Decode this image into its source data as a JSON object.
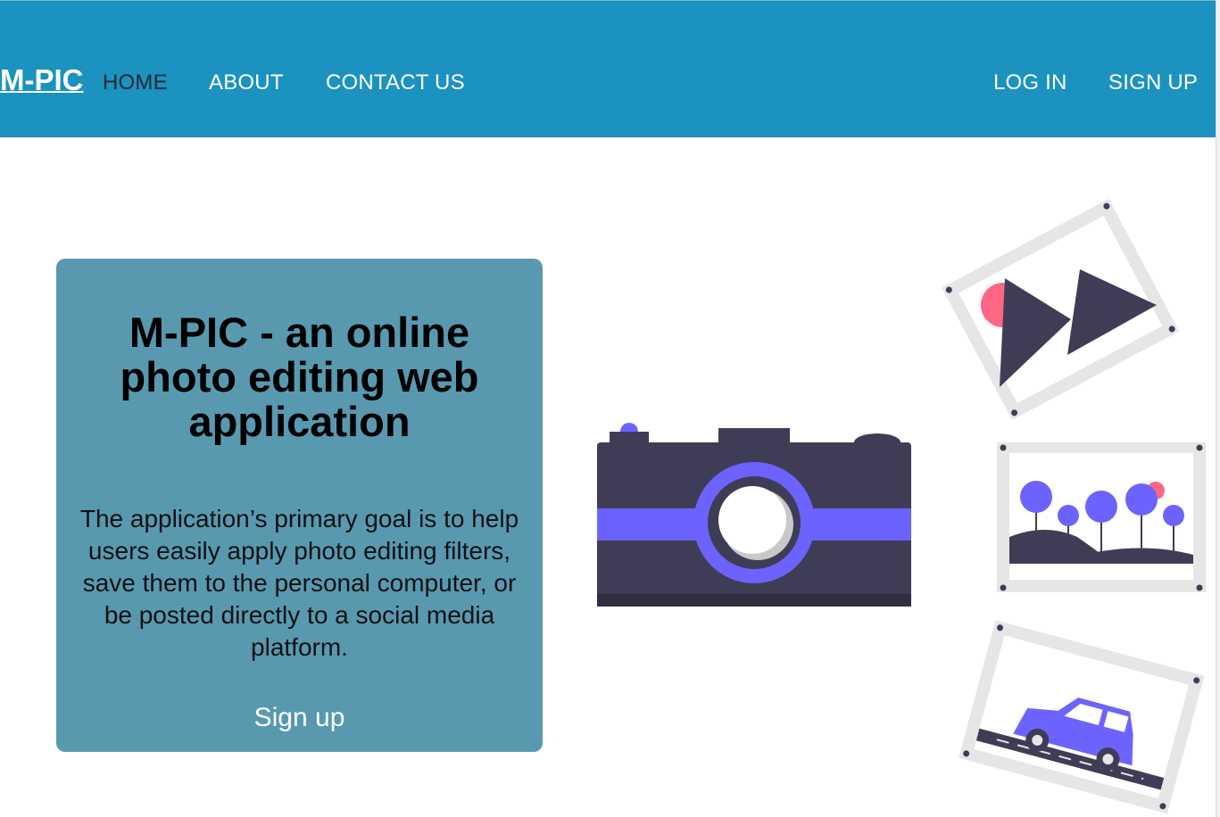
{
  "header": {
    "brand": "M-PIC",
    "nav": [
      "HOME",
      "ABOUT",
      "CONTACT US"
    ],
    "auth": [
      "LOG IN",
      "SIGN UP"
    ],
    "active_nav": "HOME"
  },
  "hero": {
    "title": "M-PIC - an online photo editing web application",
    "description": "The application’s primary goal is to help users easily apply photo editing filters, save them to the personal computer, or be posted directly to a social media platform.",
    "cta": "Sign up"
  },
  "illustration": {
    "icons": [
      "camera-illustration",
      "mountain-photo-illustration",
      "trees-photo-illustration",
      "car-photo-illustration"
    ]
  },
  "colors": {
    "header_bg": "#1b92c0",
    "card_bg": "#5899b0",
    "accent_purple": "#6c63ff",
    "dark": "#3f3d56",
    "pink": "#ff6584"
  }
}
